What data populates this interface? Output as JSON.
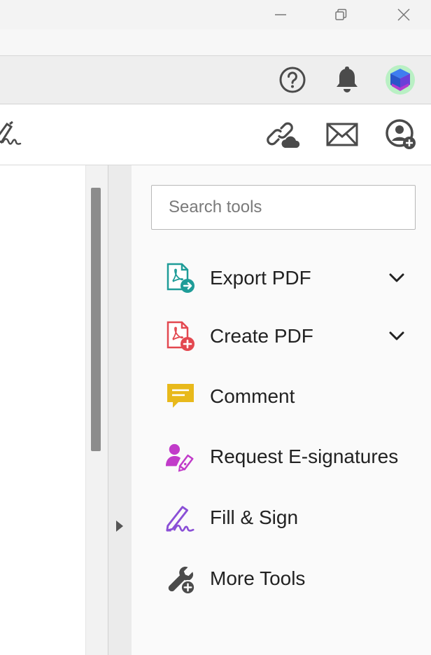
{
  "window": {
    "minimize_icon": "minimize-icon",
    "restore_icon": "restore-icon",
    "close_icon": "close-icon"
  },
  "header": {
    "help_icon": "help-icon",
    "bell_icon": "bell-icon",
    "avatar_icon": "avatar-icon"
  },
  "toolbar": {
    "sign_icon": "sign-icon",
    "share_link_icon": "share-link-icon",
    "email_icon": "email-icon",
    "add_user_icon": "add-user-icon"
  },
  "tools_pane": {
    "search_placeholder": "Search tools",
    "items": [
      {
        "label": "Export PDF",
        "icon": "export-pdf-icon",
        "color": "#1f9c98",
        "expandable": true
      },
      {
        "label": "Create PDF",
        "icon": "create-pdf-icon",
        "color": "#e34850",
        "expandable": true
      },
      {
        "label": "Comment",
        "icon": "comment-icon",
        "color": "#e8b91b",
        "expandable": false
      },
      {
        "label": "Request E-signatures",
        "icon": "request-esign-icon",
        "color": "#c13bc9",
        "expandable": false
      },
      {
        "label": "Fill & Sign",
        "icon": "fill-sign-icon",
        "color": "#8a4fd6",
        "expandable": false
      },
      {
        "label": "More Tools",
        "icon": "more-tools-icon",
        "color": "#4b4b4b",
        "expandable": false
      }
    ]
  }
}
